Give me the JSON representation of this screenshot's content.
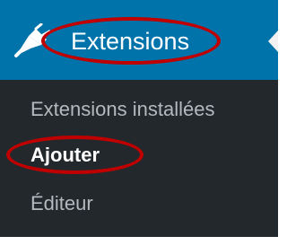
{
  "menu": {
    "header_label": "Extensions",
    "header_icon": "plugin-icon",
    "items": [
      {
        "label": "Extensions installées",
        "current": false
      },
      {
        "label": "Ajouter",
        "current": true
      },
      {
        "label": "Éditeur",
        "current": false
      }
    ]
  },
  "colors": {
    "sidebar_bg": "#23282d",
    "header_bg": "#0073aa",
    "item_text": "#b4b9be",
    "active_text": "#ffffff",
    "annotation": "#c00000"
  }
}
